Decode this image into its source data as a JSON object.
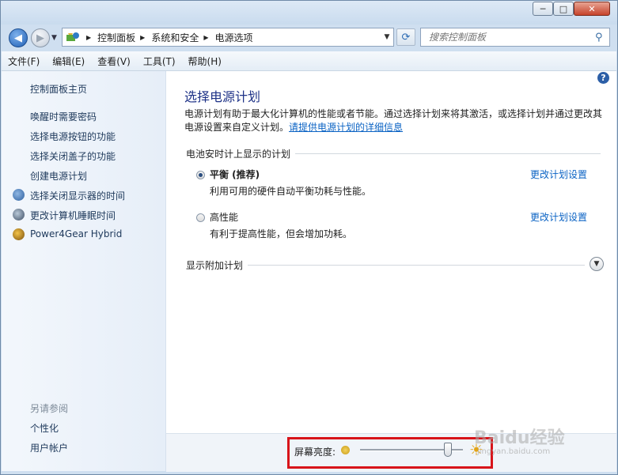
{
  "window": {
    "min": "─",
    "max": "□",
    "close": "✕"
  },
  "address": {
    "breadcrumbs": [
      "控制面板",
      "系统和安全",
      "电源选项"
    ],
    "search_placeholder": "搜索控制面板"
  },
  "menu": [
    "文件(F)",
    "编辑(E)",
    "查看(V)",
    "工具(T)",
    "帮助(H)"
  ],
  "sidebar": {
    "home": "控制面板主页",
    "links": [
      "唤醒时需要密码",
      "选择电源按钮的功能",
      "选择关闭盖子的功能",
      "创建电源计划",
      "选择关闭显示器的时间",
      "更改计算机睡眠时间",
      "Power4Gear Hybrid"
    ],
    "see_also_title": "另请参阅",
    "see_also": [
      "个性化",
      "用户帐户"
    ]
  },
  "main": {
    "title": "选择电源计划",
    "desc_text": "电源计划有助于最大化计算机的性能或者节能。通过选择计划来将其激活，或选择计划并通过更改其电源设置来自定义计划。",
    "desc_link": "请提供电源计划的详细信息",
    "section_title": "电池安时计上显示的计划",
    "plans": [
      {
        "name": "平衡 (推荐)",
        "desc": "利用可用的硬件自动平衡功耗与性能。",
        "link": "更改计划设置",
        "selected": true
      },
      {
        "name": "高性能",
        "desc": "有利于提高性能，但会增加功耗。",
        "link": "更改计划设置",
        "selected": false
      }
    ],
    "additional_plans": "显示附加计划"
  },
  "brightness": {
    "label": "屏幕亮度:",
    "level": 0.85
  },
  "watermark": {
    "text": "Baidu经验",
    "sub": "jingyan.baidu.com"
  },
  "colors": {
    "highlight_box": "#d8141a",
    "title": "#1e3287",
    "link": "#0b63c4"
  }
}
